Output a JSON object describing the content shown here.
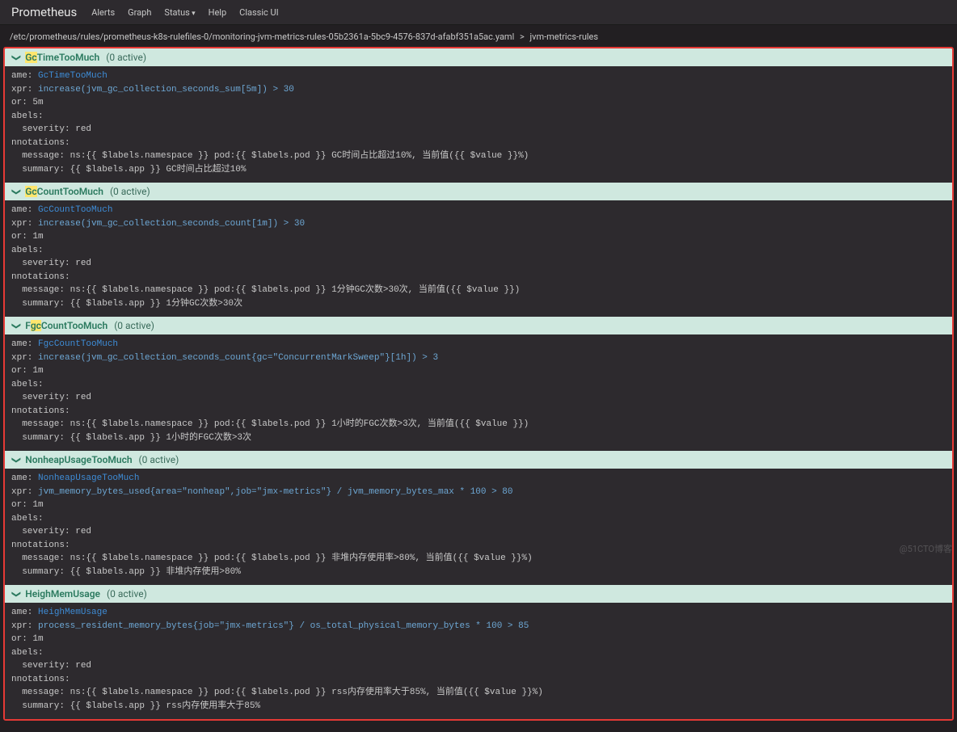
{
  "navbar": {
    "brand": "Prometheus",
    "links": [
      "Alerts",
      "Graph",
      "Status",
      "Help",
      "Classic UI"
    ]
  },
  "breadcrumb": {
    "path": "/etc/prometheus/rules/prometheus-k8s-rulefiles-0/monitoring-jvm-metrics-rules-05b2361a-5bc9-4576-837d-afabf351a5ac.yaml",
    "group": "jvm-metrics-rules"
  },
  "rules": [
    {
      "name_parts": [
        {
          "t": "Gc",
          "hl": true
        },
        {
          "t": "TimeTooMuch",
          "hl": false
        }
      ],
      "active": "(0 active)",
      "alert_name": "GcTimeTooMuch",
      "expr": "increase(jvm_gc_collection_seconds_sum[5m]) > 30",
      "for": "5m",
      "severity": "red",
      "message": "ns:{{ $labels.namespace }} pod:{{ $labels.pod }} GC时间占比超过10%, 当前值({{ $value }}%)",
      "summary": "{{ $labels.app }} GC时间占比超过10%"
    },
    {
      "name_parts": [
        {
          "t": "Gc",
          "hl": true
        },
        {
          "t": "CountTooMuch",
          "hl": false
        }
      ],
      "active": "(0 active)",
      "alert_name": "GcCountTooMuch",
      "expr": "increase(jvm_gc_collection_seconds_count[1m]) > 30",
      "for": "1m",
      "severity": "red",
      "message": "ns:{{ $labels.namespace }} pod:{{ $labels.pod }} 1分钟GC次数>30次, 当前值({{ $value }})",
      "summary": "{{ $labels.app }} 1分钟GC次数>30次"
    },
    {
      "name_parts": [
        {
          "t": "F",
          "hl": false
        },
        {
          "t": "gc",
          "hl": true
        },
        {
          "t": "CountTooMuch",
          "hl": false
        }
      ],
      "active": "(0 active)",
      "alert_name": "FgcCountTooMuch",
      "expr": "increase(jvm_gc_collection_seconds_count{gc=\"ConcurrentMarkSweep\"}[1h]) > 3",
      "for": "1m",
      "severity": "red",
      "message": "ns:{{ $labels.namespace }} pod:{{ $labels.pod }} 1小时的FGC次数>3次, 当前值({{ $value }})",
      "summary": "{{ $labels.app }} 1小时的FGC次数>3次"
    },
    {
      "name_parts": [
        {
          "t": "NonheapUsageTooMuch",
          "hl": false
        }
      ],
      "active": "(0 active)",
      "alert_name": "NonheapUsageTooMuch",
      "expr": "jvm_memory_bytes_used{area=\"nonheap\",job=\"jmx-metrics\"} / jvm_memory_bytes_max * 100 > 80",
      "for": "1m",
      "severity": "red",
      "message": "ns:{{ $labels.namespace }} pod:{{ $labels.pod }} 非堆内存使用率>80%, 当前值({{ $value }}%)",
      "summary": "{{ $labels.app }} 非堆内存使用>80%"
    },
    {
      "name_parts": [
        {
          "t": "HeighMemUsage",
          "hl": false
        }
      ],
      "active": "(0 active)",
      "alert_name": "HeighMemUsage",
      "expr": "process_resident_memory_bytes{job=\"jmx-metrics\"} / os_total_physical_memory_bytes * 100 > 85",
      "for": "1m",
      "severity": "red",
      "message": "ns:{{ $labels.namespace }} pod:{{ $labels.pod }} rss内存使用率大于85%, 当前值({{ $value }}%)",
      "summary": "{{ $labels.app }} rss内存使用率大于85%"
    }
  ],
  "watermark": "@51CTO博客"
}
